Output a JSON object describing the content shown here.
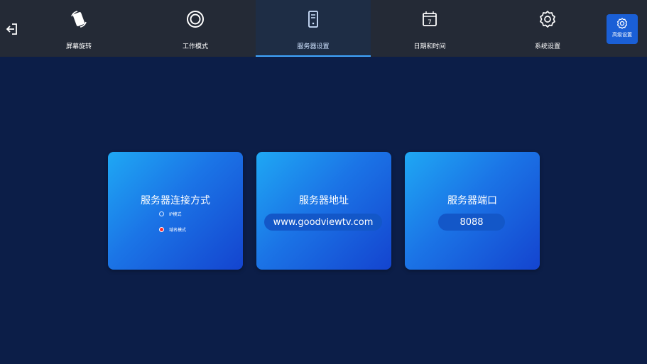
{
  "tabs": [
    {
      "label": "屏幕旋转",
      "icon": "screen-rotate-icon",
      "active": false
    },
    {
      "label": "工作模式",
      "icon": "work-mode-icon",
      "active": false
    },
    {
      "label": "服务器设置",
      "icon": "server-icon",
      "active": true
    },
    {
      "label": "日期和时间",
      "icon": "calendar-icon",
      "active": false
    },
    {
      "label": "系统设置",
      "icon": "gear-icon",
      "active": false
    }
  ],
  "advanced": {
    "label": "高级设置",
    "icon": "gear-icon"
  },
  "exit": {
    "icon": "exit-icon"
  },
  "cards": {
    "connection": {
      "title": "服务器连接方式",
      "options": [
        {
          "label": "IP模式",
          "selected": false
        },
        {
          "label": "域名模式",
          "selected": true
        }
      ]
    },
    "address": {
      "title": "服务器地址",
      "value": "www.goodviewtv.com"
    },
    "port": {
      "title": "服务器端口",
      "value": "8088"
    }
  },
  "colors": {
    "background": "#0c1e48",
    "topbar": "#242a36",
    "accent": "#41a6ff",
    "selected_radio": "#ff2a2a"
  }
}
